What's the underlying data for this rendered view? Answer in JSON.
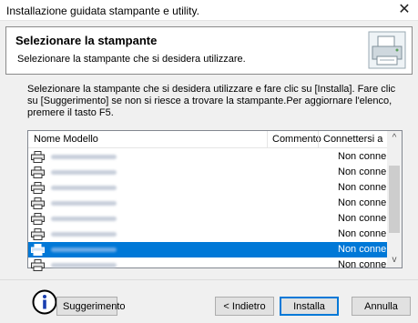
{
  "window": {
    "title": "Installazione guidata stampante e utility.",
    "close_glyph": "✕"
  },
  "header": {
    "title": "Selezionare la stampante",
    "subtitle": "Selezionare la stampante che si desidera utilizzare.",
    "icon": "printer-setup-icon"
  },
  "description": "Selezionare la stampante che si desidera utilizzare e fare clic su [Installa]. Fare clic su [Suggerimento] se non si riesce a trovare la stampante.Per aggiornare l'elenco, premere il tasto F5.",
  "printer_list": {
    "columns": [
      "Nome Modello",
      "Commento",
      "Connettersi a"
    ],
    "rows": [
      {
        "connection": "Non conne",
        "selected": false
      },
      {
        "connection": "Non conne",
        "selected": false
      },
      {
        "connection": "Non conne",
        "selected": false
      },
      {
        "connection": "Non conne",
        "selected": false
      },
      {
        "connection": "Non conne",
        "selected": false
      },
      {
        "connection": "Non conne",
        "selected": false
      },
      {
        "connection": "Non conne",
        "selected": true
      },
      {
        "connection": "Non conne",
        "selected": false
      }
    ],
    "scroll_up": "^",
    "scroll_down": "v"
  },
  "buttons": {
    "hint": "Suggerimento",
    "back": "< Indietro",
    "install": "Installa",
    "cancel": "Annulla"
  },
  "colors": {
    "selection": "#0078d7",
    "default_button_border": "#0078d7"
  }
}
